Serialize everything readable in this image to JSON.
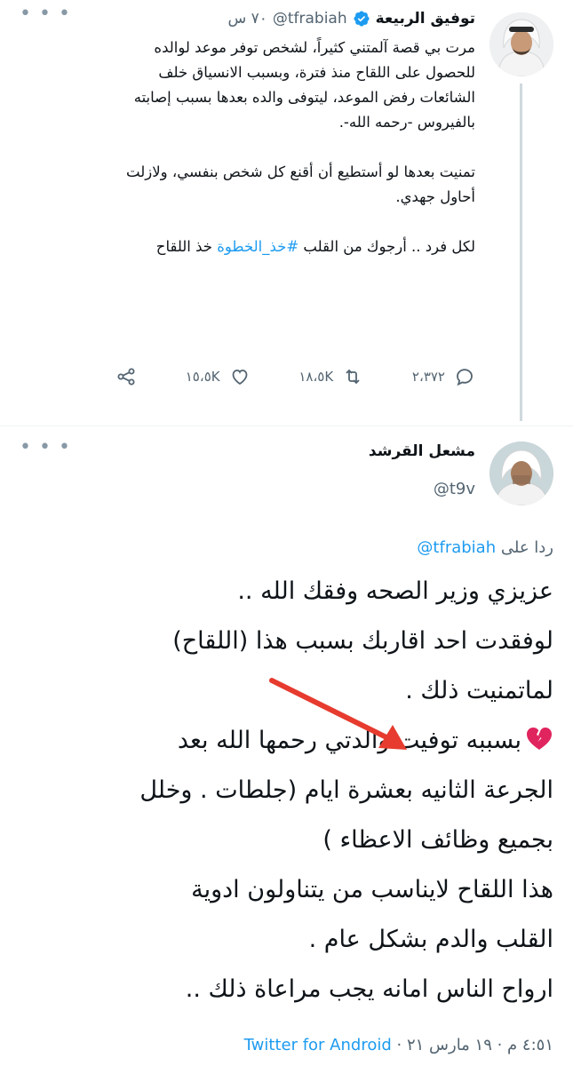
{
  "tweet1": {
    "name": "توفيق الربيعة",
    "handle": "@tfrabiah",
    "time": "٧٠ س",
    "paragraphs": [
      "مرت بي قصة آلمتني كثيراً، لشخص توفر موعد لوالده للحصول على اللقاح منذ فترة، وبسبب الانسياق خلف الشائعات رفض الموعد، ليتوفى والده بعدها بسبب إصابته بالفيروس -رحمه الله-.",
      "تمنيت بعدها لو أستطيع أن أقنع كل شخص بنفسي، ولازلت أحاول جهدي."
    ],
    "last_paragraph_before": "لكل فرد .. أرجوك من القلب ",
    "hashtag": "#خذ_الخطوة",
    "last_paragraph_after": " خذ اللقاح",
    "stats": {
      "replies": "٢،٣٧٢",
      "retweets": "١٨،٥K",
      "likes": "١٥،٥K"
    },
    "icons": [
      "reply-icon",
      "retweet-icon",
      "like-icon",
      "share-icon",
      "verified-icon",
      "more-icon"
    ]
  },
  "tweet2": {
    "name": "مشعل القرشد",
    "handle": "@t9v",
    "reply_prefix": "ردا على",
    "reply_to": "@tfrabiah",
    "lines": [
      "عزيزي وزير الصحه وفقك الله ..",
      "لوفقدت احد اقاربك بسبب هذا (اللقاح)",
      "لماتمنيت ذلك .",
      "بسببه توفيت والدتي رحمها الله بعد",
      "الجرعة الثانيه بعشرة ايام (جلطات . وخلل",
      "بجميع وظائف الاعظاء )",
      "هذا اللقاح لايناسب من يتناولون ادوية",
      "القلب والدم بشكل عام .",
      "ارواح الناس امانه يجب مراعاة ذلك .."
    ],
    "heart_emoji": "broken-heart-icon",
    "footer_time": "٤:٥١ م · ١٩ مارس ٢١ ·",
    "footer_app": "Twitter for Android"
  },
  "colors": {
    "accent": "#1d9bf0",
    "secondary_text": "#536471",
    "arrow": "#e63b2e",
    "broken_heart": "#e0245e"
  }
}
